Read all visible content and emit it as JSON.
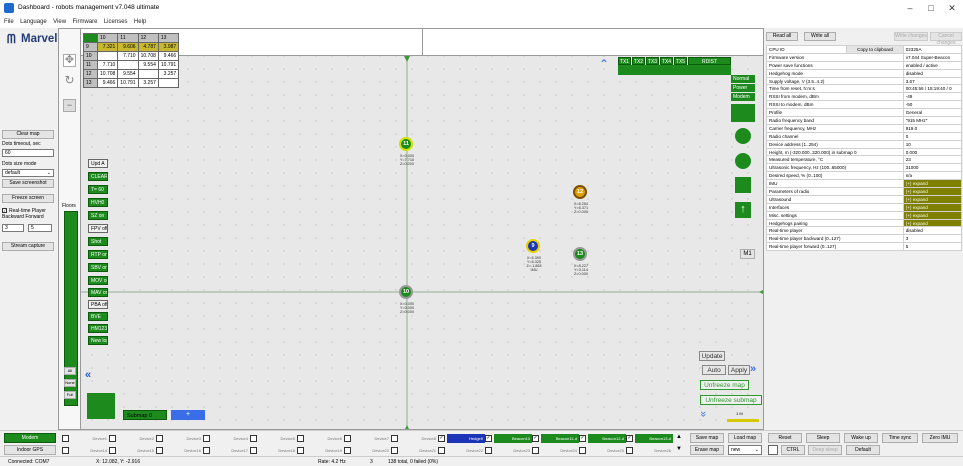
{
  "window": {
    "title": "Dashboard - robots management  v7.048  ultimate",
    "minimize": "–",
    "maximize": "□",
    "close": "✕"
  },
  "menu": [
    "File",
    "Language",
    "View",
    "Firmware",
    "Licenses",
    "Help"
  ],
  "logo": {
    "name": "Marvelmind",
    "sub": "robotics"
  },
  "left": {
    "clear_map": "Clear map",
    "dots_timeout_label": "Dots timeout, sec",
    "dots_timeout_value": "60",
    "dots_size_label": "Dots size mode",
    "dots_size_value": "default",
    "save_screenshot": "Save screenshot",
    "freeze_screen": "Freeze screen",
    "realtime_player": "Real-time Player",
    "backward_forward": "Backward Forward",
    "backward_value": "3",
    "forward_value": "5",
    "stream_capture": "Stream capture"
  },
  "distance_table": {
    "header": [
      "",
      "10",
      "11",
      "12",
      "13"
    ],
    "rows": [
      [
        "9",
        "7.321",
        "9.606",
        "4.787",
        "3.987"
      ],
      [
        "10",
        "",
        "7.710",
        "10.708",
        "9.466"
      ],
      [
        "11",
        "7.710",
        "",
        "9.554",
        "10.791"
      ],
      [
        "12",
        "10.708",
        "9.554",
        "",
        "3.257"
      ],
      [
        "13",
        "9.466",
        "10.791",
        "3.257",
        ""
      ]
    ]
  },
  "map_buttons": [
    "Upd A",
    "CLEAR",
    "T= 60",
    "HVH0",
    "SZ on",
    "FPV off",
    "Shot",
    "RTP on",
    "SBV on",
    "MOV on",
    "MAV on",
    "PBA off",
    "BVE",
    "HM123",
    "New log"
  ],
  "floors_label": "Floors",
  "zoom_buttons": [
    "All",
    "None",
    "Full"
  ],
  "submap": {
    "label": "Submap 0",
    "add": "+"
  },
  "tx_tabs": [
    "TX1",
    "TX2",
    "TX3",
    "TX4",
    "TX5",
    "RDIST"
  ],
  "status_cells": [
    "Normal",
    "Power",
    "Modem"
  ],
  "m1_label": "M1",
  "beacons": [
    {
      "id": "11",
      "coords": "X=0.000\nY=7.710\nZ=0.000"
    },
    {
      "id": "12",
      "coords": "X=8.264\nY=6.371\nZ=0.000"
    },
    {
      "id": "9",
      "coords": "X=6.390\nY=6.325\nZ=-1.864\nIMU"
    },
    {
      "id": "13",
      "coords": "X=8.227\nY=3.114\nZ=0.000"
    },
    {
      "id": "10",
      "coords": "X=0.000\nY=0.000\nZ=0.000"
    }
  ],
  "map_controls": {
    "update": "Update",
    "auto": "Auto",
    "apply": "Apply",
    "unfreeze_map": "Unfreeze map",
    "unfreeze_submap": "Unfreeze submap",
    "scale": "1 M"
  },
  "right": {
    "read_all": "Read all",
    "write_all": "Write all",
    "write_changes": "Write changes",
    "cancel_changes": "Cancel changes",
    "copy_clipboard": "Copy to clipboard",
    "params": [
      [
        "CPU ID",
        "02325A"
      ],
      [
        "Firmware version",
        "v7.044 Super-Beacon"
      ],
      [
        "Power save functions",
        "enabled / active"
      ],
      [
        "Hedgehog mode",
        "disabled"
      ],
      [
        "Supply voltage, V (3.5..4.2)",
        "3.67"
      ],
      [
        "Time from reset, h:m:s",
        "00:45:56 / 15:19:40 / 0"
      ],
      [
        "RSSI from modem, dBm",
        "-49"
      ],
      [
        "RSSI to modem, dBm",
        "-50"
      ],
      [
        "Profile",
        "General"
      ],
      [
        "Radio frequency band",
        "\"915 MHz\""
      ],
      [
        "Carrier frequency, MHz",
        "919.0"
      ],
      [
        "Radio channel",
        "0"
      ],
      [
        "Device address (1..254)",
        "10"
      ],
      [
        "Height, m (-320.000..320.000) in submap 0",
        "0.000"
      ],
      [
        "Measured temperature, °C",
        "23"
      ],
      [
        "Ultrasonic frequency, Hz (100..65000)",
        "31000"
      ],
      [
        "Desired speed, % (0..100)",
        "n/a"
      ],
      [
        "IMU",
        "(+) expand"
      ],
      [
        "Parameters of radio",
        "(+) expand"
      ],
      [
        "Ultrasound",
        "(+) expand"
      ],
      [
        "Interfaces",
        "(+) expand"
      ],
      [
        "Misc. settings",
        "(+) expand"
      ],
      [
        "Hedgehogs pairing",
        "(+) expand"
      ],
      [
        "Real-time player",
        "disabled"
      ],
      [
        "Real-time player backward (0..127)",
        "3"
      ],
      [
        "Real-time player forward (0..127)",
        "5"
      ]
    ]
  },
  "bottom": {
    "modem": "Modem",
    "indoor_gps": "Indoor GPS",
    "devices_row1": [
      "Device1",
      "Device2",
      "Device3",
      "Device4",
      "Device5",
      "Device6",
      "Device7",
      "Device8",
      "Hedge9",
      "Beacon10",
      "Beacon11-d",
      "Beacon12-d",
      "Beacon13-d"
    ],
    "devices_row2": [
      "Device14",
      "Device15",
      "Device16",
      "Device17",
      "Device18",
      "Device19",
      "Device20",
      "Device21",
      "Device22",
      "Device23",
      "Device24",
      "Device25",
      "Device26"
    ],
    "save_map": "Save map",
    "load_map": "Load map",
    "erase_map": "Erase map",
    "map_mode": "new",
    "reset": "Reset",
    "sleep": "Sleep",
    "wake_up": "Wake up",
    "time_sync": "Time sync",
    "zero_imu": "Zero IMU",
    "ctrl": "CTRL",
    "deep_sleep": "Deep sleep",
    "default": "Default"
  },
  "status": {
    "connected": "Connected: COM7",
    "xy": "X: 12.082, Y: -2.916",
    "rate": "Rate: 4.2 Hz",
    "count": "3",
    "total": "138 total, 0 failed (0%)"
  },
  "colors": {
    "green": "#1d8a1d",
    "olive": "#7f7f00",
    "blue": "#1c35b8",
    "orange": "#e0a000"
  }
}
